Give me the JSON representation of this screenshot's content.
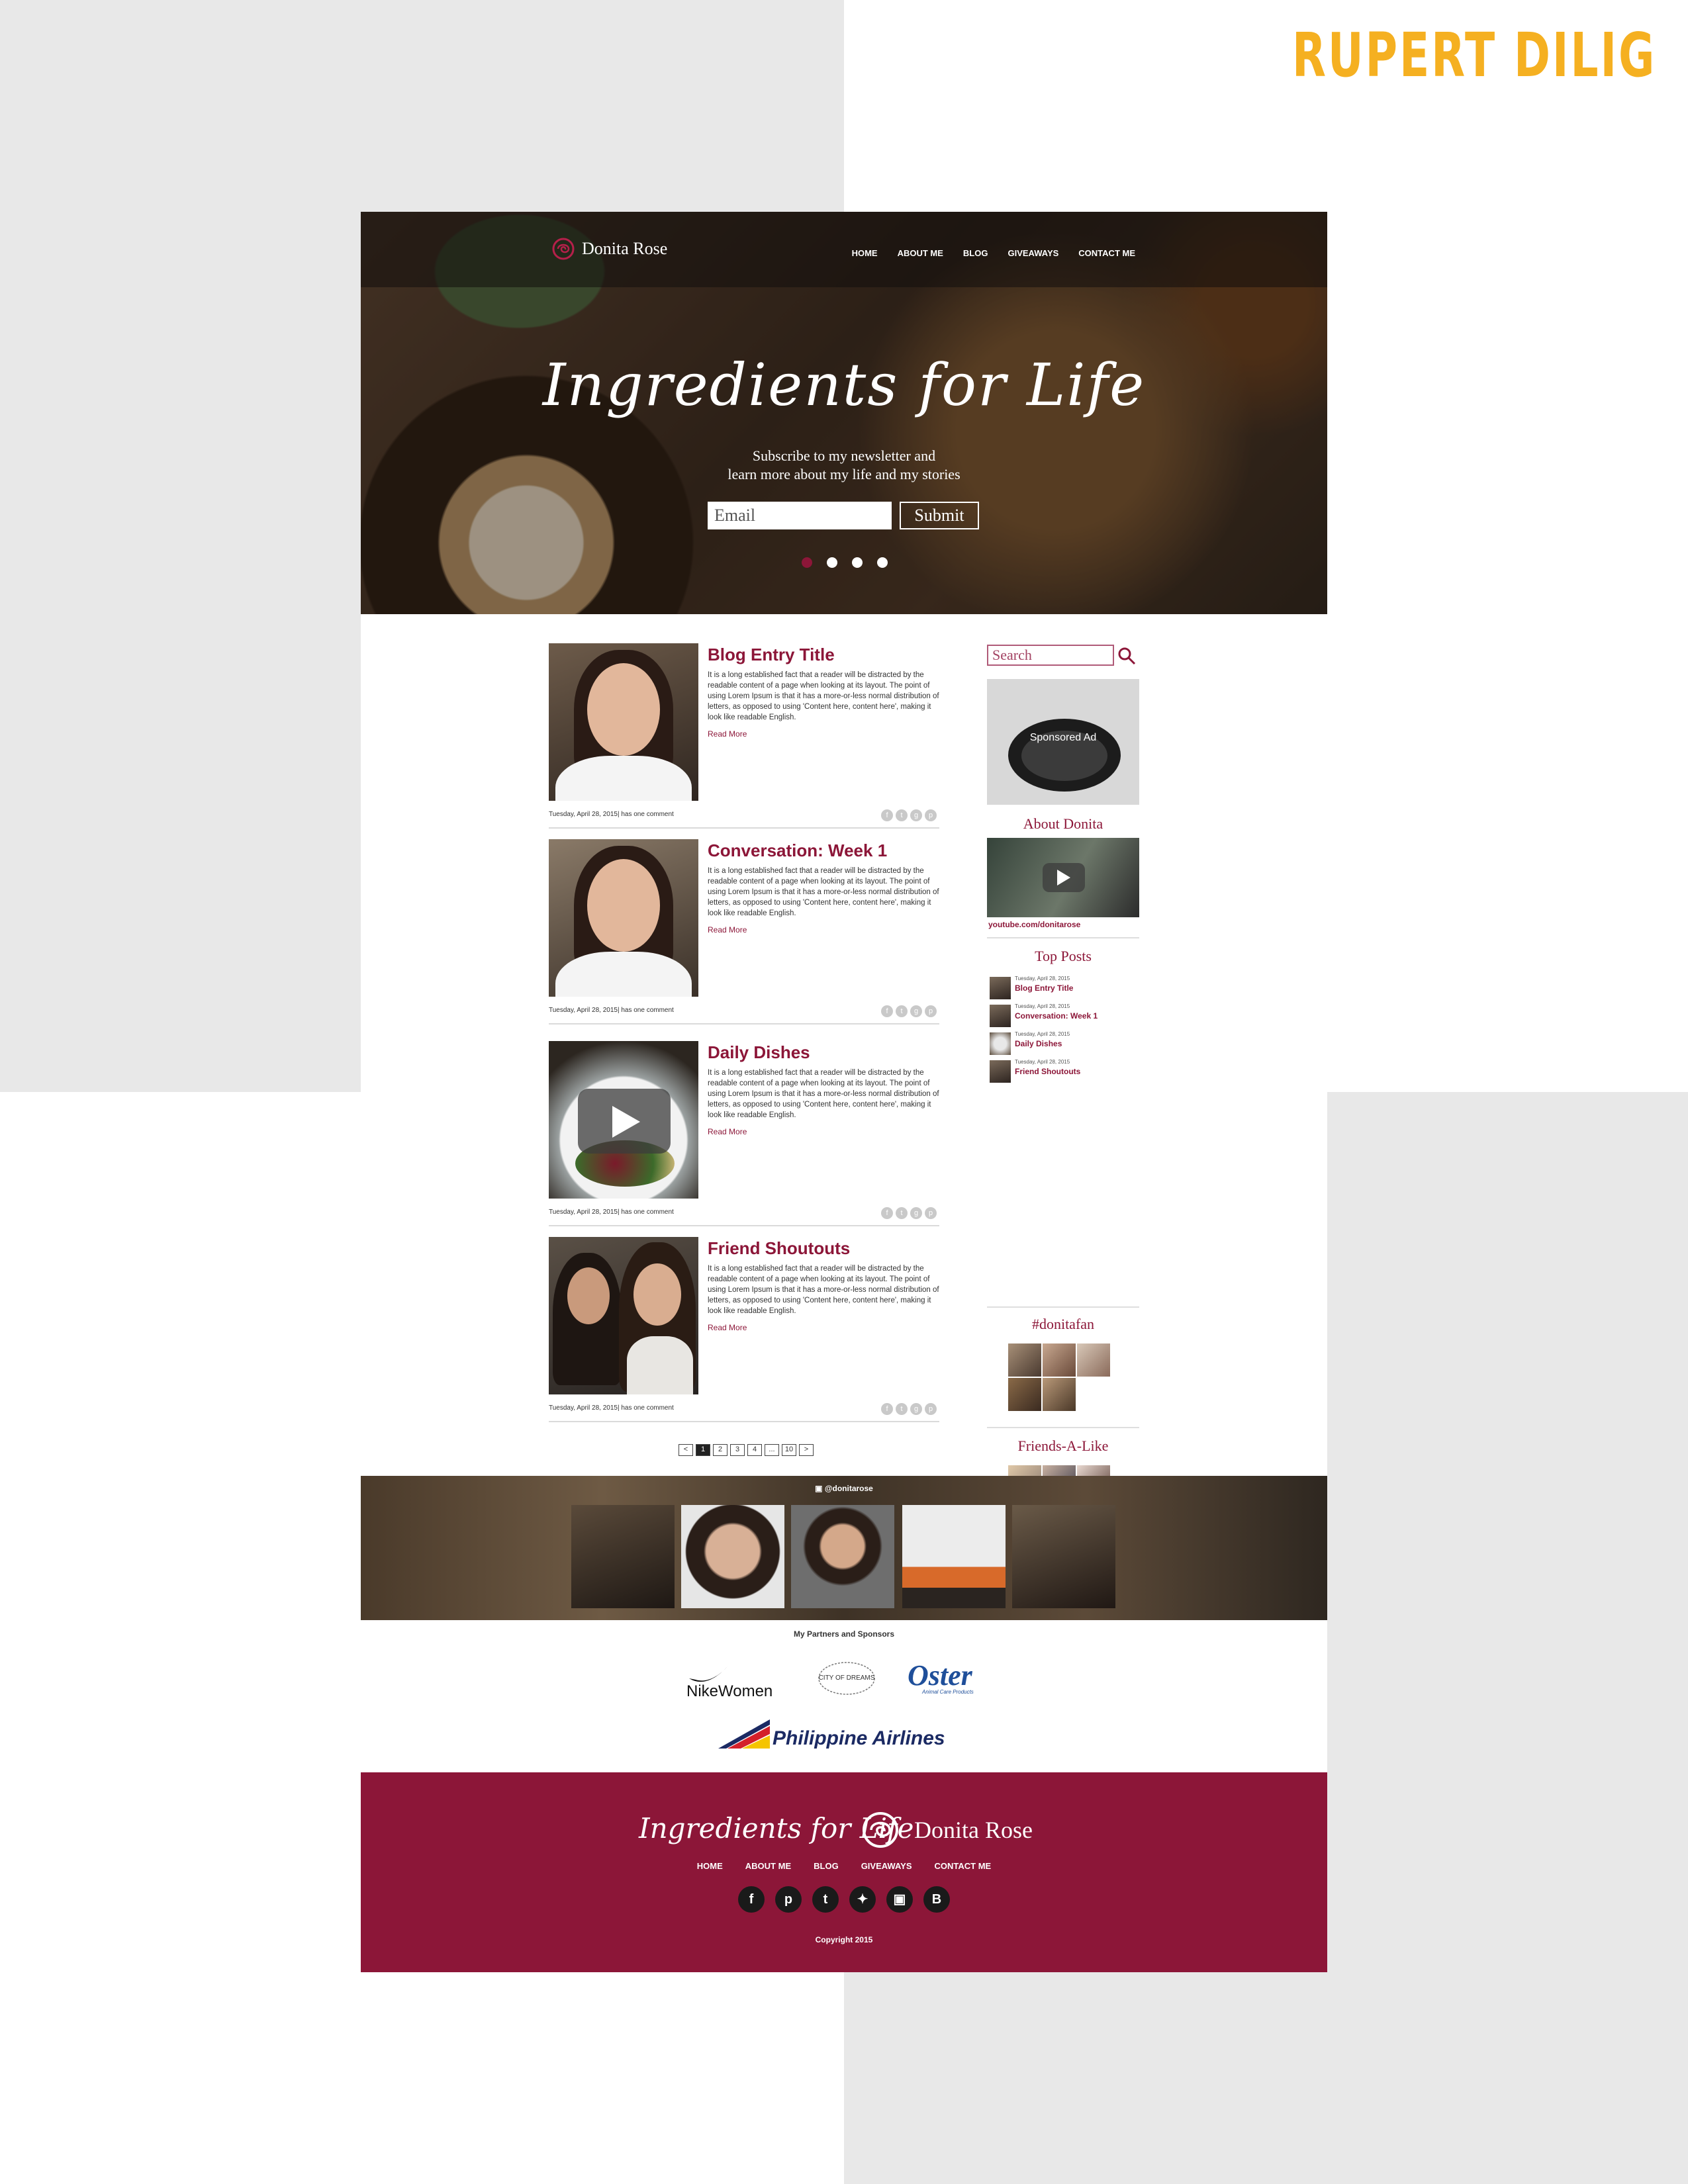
{
  "author": "RUPERT DILIG",
  "site": {
    "brand": "Donita Rose",
    "nav": [
      "HOME",
      "ABOUT ME",
      "BLOG",
      "GIVEAWAYS",
      "CONTACT ME"
    ]
  },
  "hero": {
    "title": "Ingredients for Life",
    "subtitle": "Subscribe to my newsletter and\nlearn more about my life and my stories",
    "email_placeholder": "Email",
    "submit_label": "Submit",
    "slides": 4,
    "active_slide": 1
  },
  "posts": [
    {
      "title": "Blog Entry Title",
      "excerpt": "It is a long established fact that a reader will be distracted by the readable content of a page when looking at its layout. The point of using Lorem Ipsum is that it has a more-or-less normal distribution of letters, as opposed to using 'Content here, content here', making it look like readable English.",
      "read_more": "Read More",
      "meta": "Tuesday, April 28, 2015| has one comment"
    },
    {
      "title": "Conversation: Week 1",
      "excerpt": "It is a long established fact that a reader will be distracted by the readable content of a page when looking at its layout. The point of using Lorem Ipsum is that it has a more-or-less normal distribution of letters, as opposed to using 'Content here, content here', making it look like readable English.",
      "read_more": "Read More",
      "meta": "Tuesday, April 28, 2015| has one comment"
    },
    {
      "title": "Daily Dishes",
      "excerpt": "It is a long established fact that a reader will be distracted by the readable content of a page when looking at its layout. The point of using Lorem Ipsum is that it has a more-or-less normal distribution of letters, as opposed to using 'Content here, content here', making it look like readable English.",
      "read_more": "Read More",
      "meta": "Tuesday, April 28, 2015| has one comment"
    },
    {
      "title": "Friend Shoutouts",
      "excerpt": "It is a long established fact that a reader will be distracted by the readable content of a page when looking at its layout. The point of using Lorem Ipsum is that it has a more-or-less normal distribution of letters, as opposed to using 'Content here, content here', making it look like readable English.",
      "read_more": "Read More",
      "meta": "Tuesday, April 28, 2015| has one comment"
    }
  ],
  "share_icons": [
    "facebook-icon",
    "twitter-icon",
    "google-plus-icon",
    "pinterest-icon"
  ],
  "pagination": [
    "<",
    "1",
    "2",
    "3",
    "4",
    "...",
    "10",
    ">"
  ],
  "sidebar": {
    "search_placeholder": "Search",
    "ad_label": "Sponsored Ad",
    "about_heading": "About Donita",
    "youtube_link": "youtube.com/donitarose",
    "top_posts_heading": "Top Posts",
    "top_posts": [
      {
        "date": "Tuesday, April 28, 2015",
        "title": "Blog Entry Title"
      },
      {
        "date": "Tuesday, April 28, 2015",
        "title": "Conversation: Week 1"
      },
      {
        "date": "Tuesday, April 28, 2015",
        "title": "Daily Dishes"
      },
      {
        "date": "Tuesday, April 28, 2015",
        "title": "Friend Shoutouts"
      }
    ],
    "hashtag_heading": "#donitafan",
    "friends_heading": "Friends-A-Like"
  },
  "instagram": {
    "handle": "@donitarose"
  },
  "partners": {
    "title": "My Partners and Sponsors",
    "nike": "NikeWomen",
    "city_of_dreams": "CITY OF DREAMS",
    "oster": "Oster",
    "oster_sub": "Animal Care Products",
    "pal": "Philippine Airlines"
  },
  "footer": {
    "title": "Ingredients for Life",
    "brand": "Donita Rose",
    "nav": [
      "HOME",
      "ABOUT ME",
      "BLOG",
      "GIVEAWAYS",
      "CONTACT ME"
    ],
    "socials": [
      "f",
      "p",
      "t",
      "tw",
      "ig",
      "b"
    ],
    "copyright": "Copyright 2015"
  },
  "colors": {
    "accent": "#8c1638",
    "author": "#f5b021",
    "background": "#e8e8e8"
  }
}
